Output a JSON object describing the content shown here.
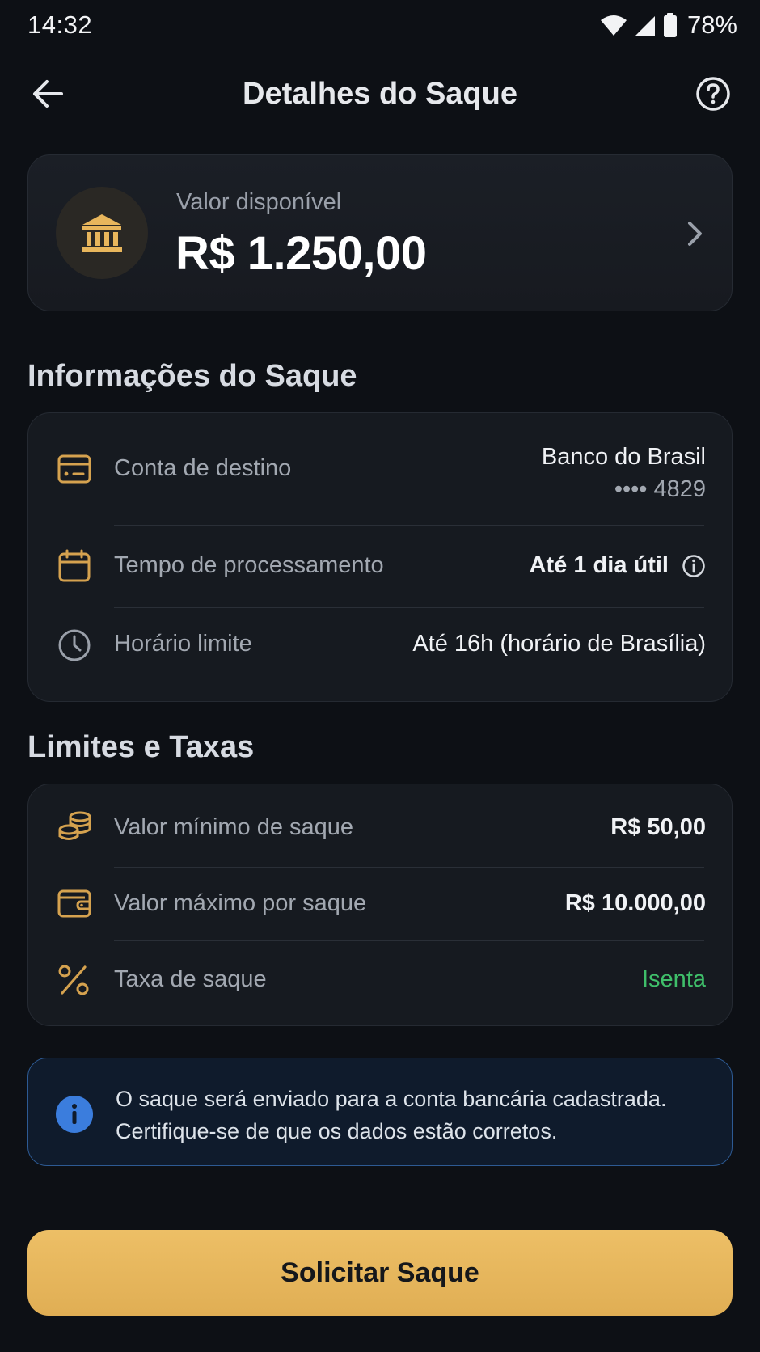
{
  "status_bar": {
    "time": "14:32",
    "battery_percent": "78%",
    "icons": [
      "wifi-icon",
      "signal-icon",
      "battery-icon"
    ]
  },
  "header": {
    "title": "Detalhes do Saque",
    "back_icon": "arrow-left-icon",
    "help_icon": "help-circle-icon"
  },
  "balance": {
    "label": "Valor disponível",
    "value": "R$ 1.250,00",
    "icon": "bank-icon"
  },
  "info_section": {
    "title": "Informações do Saque",
    "rows": [
      {
        "icon": "card-icon",
        "label": "Conta de destino",
        "value": "Banco do Brasil",
        "subvalue": "•••• 4829"
      },
      {
        "icon": "calendar-icon",
        "label": "Tempo de processamento",
        "value": "Até 1 dia útil"
      },
      {
        "icon": "clock-icon",
        "label": "Horário limite",
        "value": "Até 16h (horário de Brasília)"
      }
    ]
  },
  "limits_section": {
    "title": "Limites e Taxas",
    "rows": [
      {
        "icon": "coins-icon",
        "label": "Valor mínimo de saque",
        "value": "R$ 50,00"
      },
      {
        "icon": "wallet-icon",
        "label": "Valor máximo por saque",
        "value": "R$ 10.000,00"
      },
      {
        "icon": "percent-icon",
        "label": "Taxa de saque",
        "value": "Isenta"
      }
    ]
  },
  "notice": {
    "line1": "O saque será enviado para a conta bancária cadastrada.",
    "line2": "Certifique-se de que os dados estão corretos."
  },
  "cta": {
    "label": "Solicitar Saque"
  },
  "colors": {
    "background": "#0d1015",
    "accent_gold": "#e8b65c",
    "success_green": "#3fbf6a",
    "info_blue": "#3b7ddd"
  }
}
